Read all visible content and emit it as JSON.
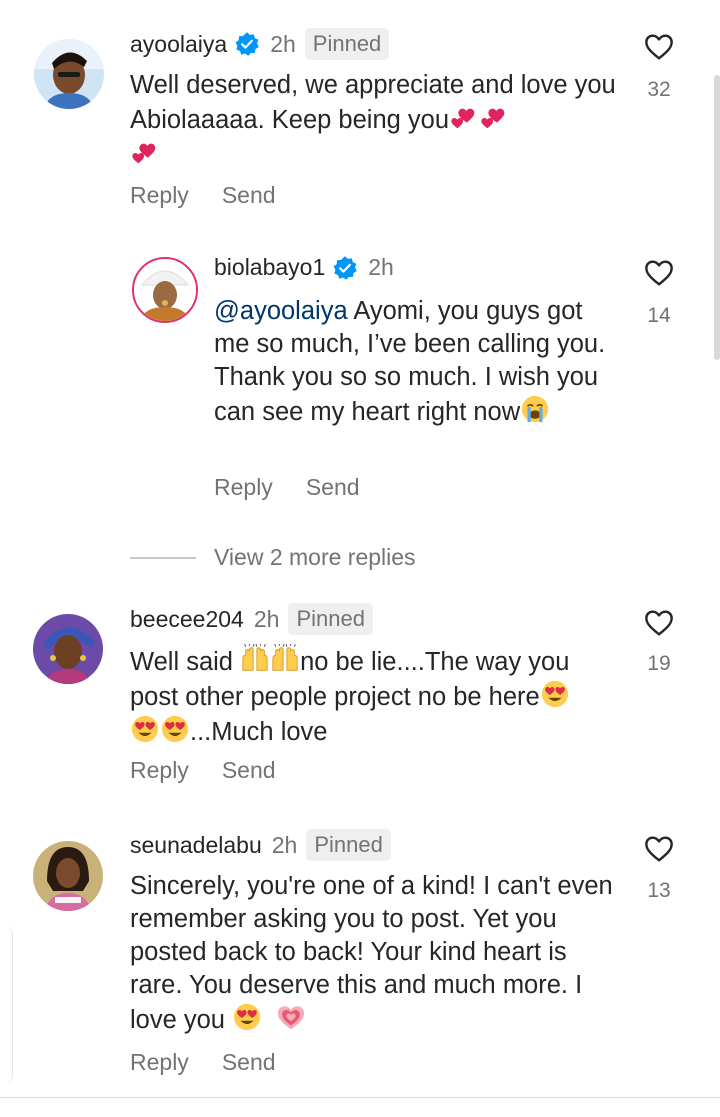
{
  "comments": [
    {
      "username": "ayoolaiya",
      "verified": true,
      "time": "2h",
      "pinned_label": "Pinned",
      "text": "Well deserved, we appreciate and love you Abiolaaaaa. Keep being you",
      "emojis": [
        "two-hearts",
        "two-hearts",
        "two-hearts"
      ],
      "likes": "32",
      "reply_label": "Reply",
      "send_label": "Send"
    },
    {
      "username": "biolabayo1",
      "verified": true,
      "time": "2h",
      "mention": "@ayoolaiya",
      "text": " Ayomi, you guys got me so much, I’ve been calling you. Thank you so so much. I wish you can see my heart right now",
      "emojis": [
        "loudly-crying-face"
      ],
      "likes": "14",
      "reply_label": "Reply",
      "send_label": "Send"
    },
    {
      "username": "beecee204",
      "verified": false,
      "time": "2h",
      "pinned_label": "Pinned",
      "text_parts": [
        "Well said ",
        "no be lie....The way you post other people project no be here",
        "...Much love"
      ],
      "emojis": [
        "raising-hands",
        "raising-hands",
        "heart-eyes",
        "heart-eyes",
        "heart-eyes"
      ],
      "likes": "19",
      "reply_label": "Reply",
      "send_label": "Send"
    },
    {
      "username": "seunadelabu",
      "verified": false,
      "time": "2h",
      "pinned_label": "Pinned",
      "text": "Sincerely, you're one of a kind! I can't even remember asking you to post. Yet you posted back to back! Your kind heart is rare. You deserve this and much more. I love you ",
      "emojis": [
        "heart-eyes",
        "growing-heart"
      ],
      "likes": "13",
      "reply_label": "Reply",
      "send_label": "Send"
    }
  ],
  "view_more_replies": "View 2 more replies",
  "colors": {
    "text": "#262626",
    "muted": "#737373",
    "verified": "#0095f6",
    "mention": "#00376b"
  }
}
